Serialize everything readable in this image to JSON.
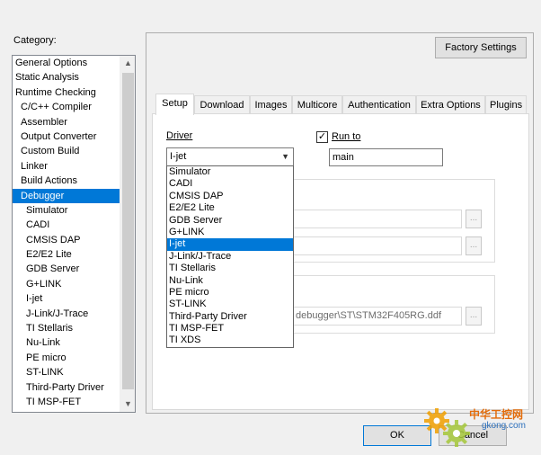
{
  "category": {
    "label": "Category:",
    "items": [
      {
        "label": "General Options",
        "level": 0,
        "selected": false
      },
      {
        "label": "Static Analysis",
        "level": 0,
        "selected": false
      },
      {
        "label": "Runtime Checking",
        "level": 0,
        "selected": false
      },
      {
        "label": "C/C++ Compiler",
        "level": 1,
        "selected": false
      },
      {
        "label": "Assembler",
        "level": 1,
        "selected": false
      },
      {
        "label": "Output Converter",
        "level": 1,
        "selected": false
      },
      {
        "label": "Custom Build",
        "level": 1,
        "selected": false
      },
      {
        "label": "Linker",
        "level": 1,
        "selected": false
      },
      {
        "label": "Build Actions",
        "level": 1,
        "selected": false
      },
      {
        "label": "Debugger",
        "level": 1,
        "selected": true
      },
      {
        "label": "Simulator",
        "level": 2,
        "selected": false
      },
      {
        "label": "CADI",
        "level": 2,
        "selected": false
      },
      {
        "label": "CMSIS DAP",
        "level": 2,
        "selected": false
      },
      {
        "label": "E2/E2 Lite",
        "level": 2,
        "selected": false
      },
      {
        "label": "GDB Server",
        "level": 2,
        "selected": false
      },
      {
        "label": "G+LINK",
        "level": 2,
        "selected": false
      },
      {
        "label": "I-jet",
        "level": 2,
        "selected": false
      },
      {
        "label": "J-Link/J-Trace",
        "level": 2,
        "selected": false
      },
      {
        "label": "TI Stellaris",
        "level": 2,
        "selected": false
      },
      {
        "label": "Nu-Link",
        "level": 2,
        "selected": false
      },
      {
        "label": "PE micro",
        "level": 2,
        "selected": false
      },
      {
        "label": "ST-LINK",
        "level": 2,
        "selected": false
      },
      {
        "label": "Third-Party Driver",
        "level": 2,
        "selected": false
      },
      {
        "label": "TI MSP-FET",
        "level": 2,
        "selected": false
      }
    ],
    "scroll_up_icon": "▲",
    "scroll_down_icon": "▼"
  },
  "panel": {
    "factory_settings_label": "Factory Settings",
    "tabs": [
      {
        "label": "Setup",
        "active": true
      },
      {
        "label": "Download",
        "active": false
      },
      {
        "label": "Images",
        "active": false
      },
      {
        "label": "Multicore",
        "active": false
      },
      {
        "label": "Authentication",
        "active": false
      },
      {
        "label": "Extra Options",
        "active": false
      },
      {
        "label": "Plugins",
        "active": false
      }
    ],
    "driver_label": "Driver",
    "driver_value": "I-jet",
    "driver_arrow": "▼",
    "run_to_label": "Run to",
    "run_to_checked": true,
    "run_to_check_glyph": "✓",
    "run_to_value": "main",
    "ddf_path": "debugger\\ST\\STM32F405RG.ddf",
    "browse_label": "...",
    "driver_options": [
      {
        "label": "Simulator",
        "selected": false
      },
      {
        "label": "CADI",
        "selected": false
      },
      {
        "label": "CMSIS DAP",
        "selected": false
      },
      {
        "label": "E2/E2 Lite",
        "selected": false
      },
      {
        "label": "GDB Server",
        "selected": false
      },
      {
        "label": "G+LINK",
        "selected": false
      },
      {
        "label": "I-jet",
        "selected": true
      },
      {
        "label": "J-Link/J-Trace",
        "selected": false
      },
      {
        "label": "TI Stellaris",
        "selected": false
      },
      {
        "label": "Nu-Link",
        "selected": false
      },
      {
        "label": "PE micro",
        "selected": false
      },
      {
        "label": "ST-LINK",
        "selected": false
      },
      {
        "label": "Third-Party Driver",
        "selected": false
      },
      {
        "label": "TI MSP-FET",
        "selected": false
      },
      {
        "label": "TI XDS",
        "selected": false
      }
    ]
  },
  "footer": {
    "ok_label": "OK",
    "cancel_label": "Cancel"
  },
  "watermark": {
    "line1": "中华工控网",
    "line2": "gkong.com"
  },
  "colors": {
    "selection": "#0078d7",
    "watermark_orange": "#e36c0a",
    "watermark_blue": "#2a6ebb"
  }
}
